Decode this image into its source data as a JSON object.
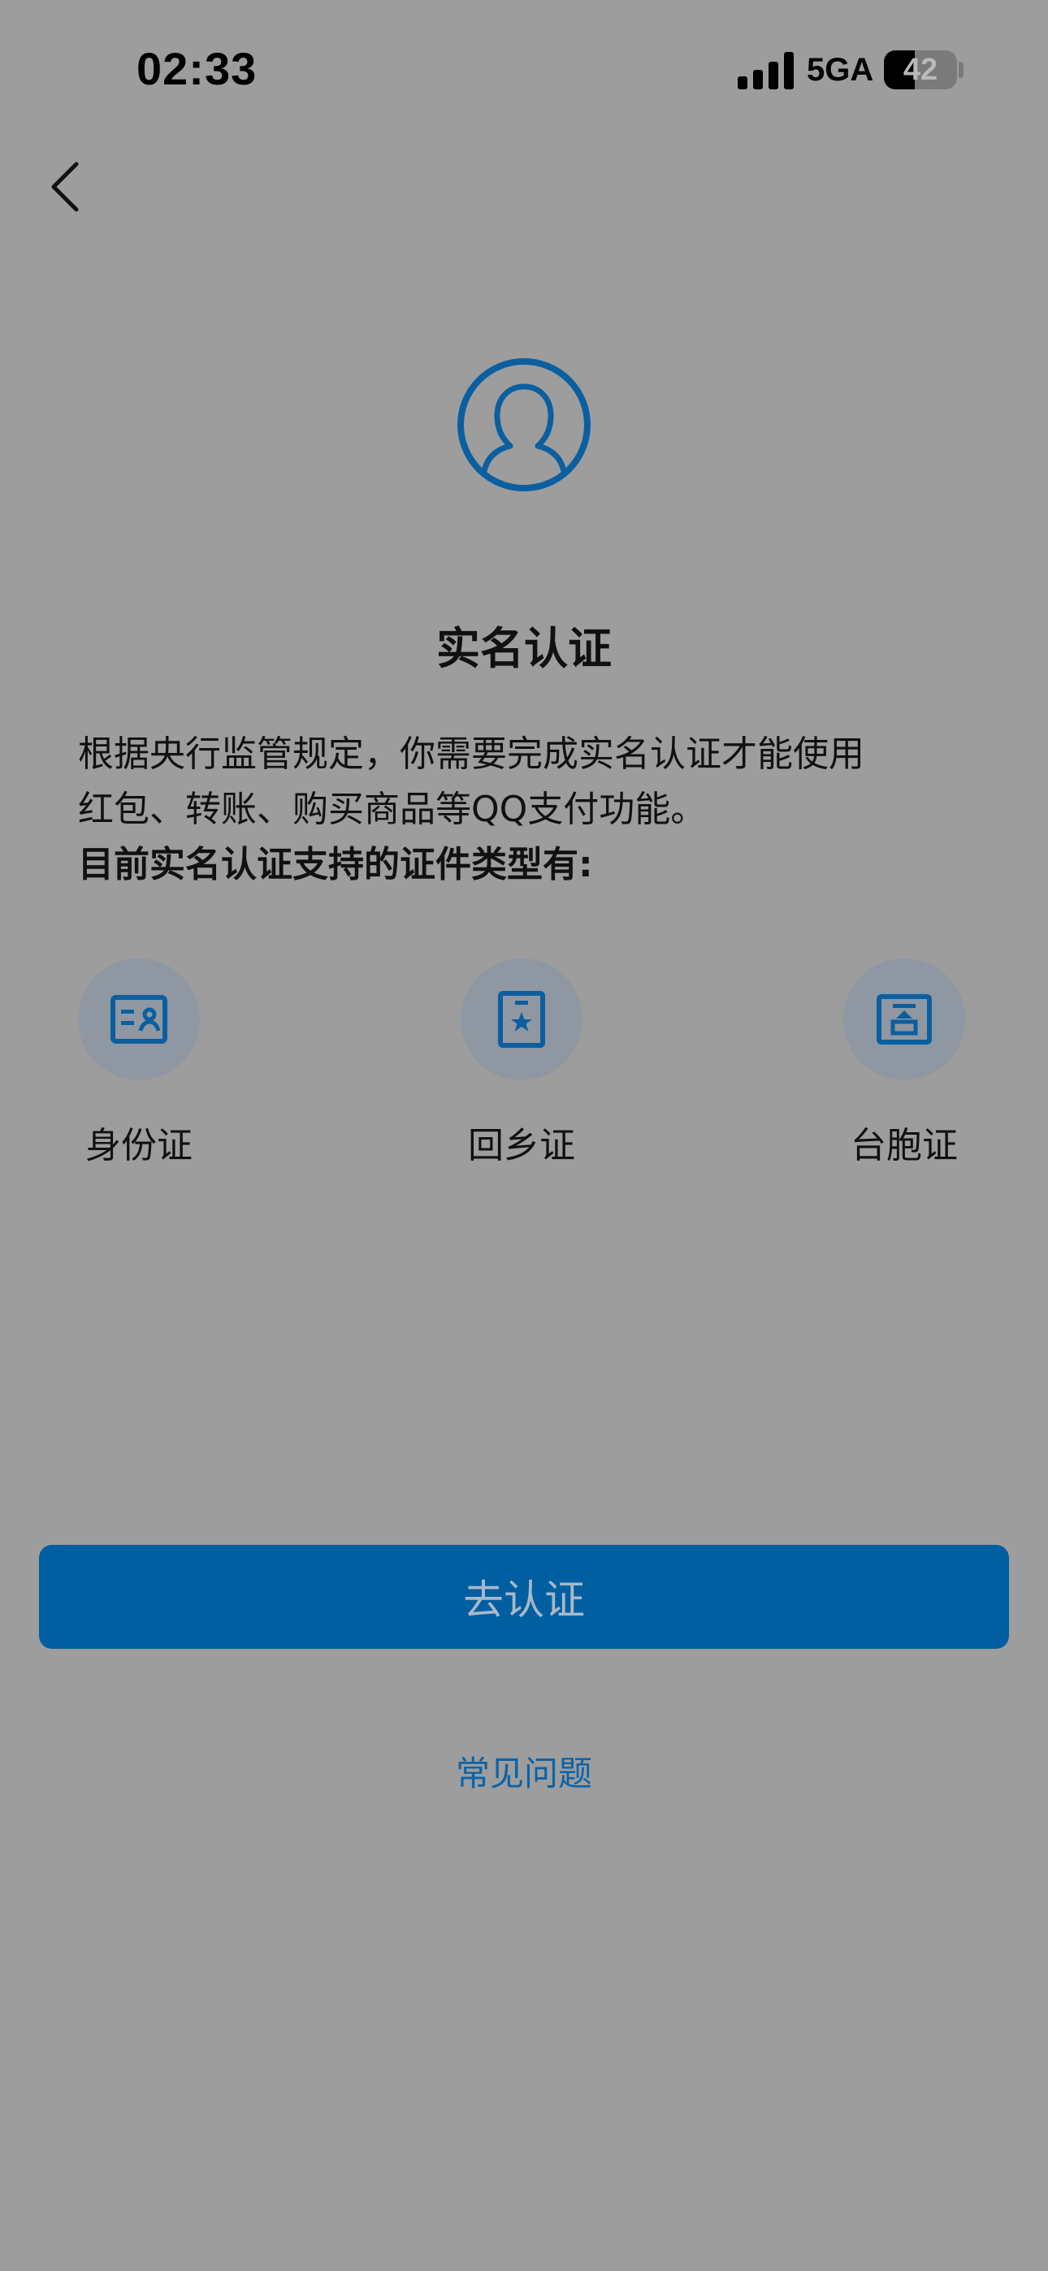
{
  "status_bar": {
    "time": "02:33",
    "network": "5GA",
    "battery_percent": "42",
    "battery_level": 0.42
  },
  "header": {
    "back_icon": "chevron-left-icon"
  },
  "hero": {
    "icon": "user-avatar-icon",
    "title": "实名认证"
  },
  "description": {
    "line1": "根据央行监管规定，你需要完成实名认证才能使用",
    "line2": "红包、转账、购买商品等QQ支付功能。",
    "line3": "目前实名认证支持的证件类型有:"
  },
  "document_types": [
    {
      "label": "身份证",
      "icon": "id-card-icon"
    },
    {
      "label": "回乡证",
      "icon": "home-return-permit-icon"
    },
    {
      "label": "台胞证",
      "icon": "taiwan-compatriot-permit-icon"
    }
  ],
  "actions": {
    "verify_label": "去认证",
    "faq_label": "常见问题"
  },
  "colors": {
    "background": "#9d9d9d",
    "accent": "#005fa1",
    "icon_blue": "#0b5fa0",
    "circle_bg": "#8f97a2",
    "link": "#0b63a8"
  }
}
